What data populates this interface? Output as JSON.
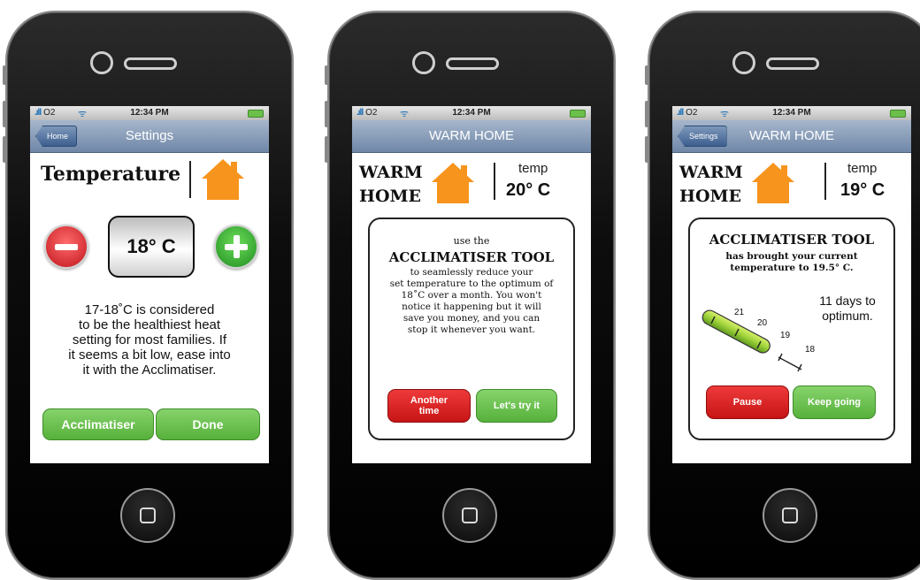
{
  "status": {
    "carrier": "O2",
    "time": "12:34 PM"
  },
  "screen1": {
    "nav": {
      "back": "Home",
      "title": "Settings"
    },
    "heading": "Temperature",
    "temperature": "18° C",
    "info": "17-18˚C is considered\nto be the healthiest heat\nsetting for most families. If\nit seems a bit low, ease into\nit with the Acclimatiser.",
    "buttons": {
      "acclimatiser": "Acclimatiser",
      "done": "Done"
    }
  },
  "screen2": {
    "nav": {
      "title": "WARM HOME"
    },
    "title_line1": "WARM",
    "title_line2": "HOME",
    "temp_label": "temp",
    "temp_value": "20° C",
    "panel": {
      "use_the": "use the",
      "tool": "ACCLIMATISER TOOL",
      "description": "to seamlessly reduce your\nset temperature to the optimum of\n18˚C over a month.  You won't\nnotice it happening but it will\nsave you money, and you can\nstop it whenever you want."
    },
    "buttons": {
      "another": "Another\ntime",
      "try": "Let's try it"
    }
  },
  "screen3": {
    "nav": {
      "back": "Settings",
      "title": "WARM HOME"
    },
    "title_line1": "WARM",
    "title_line2": "HOME",
    "temp_label": "temp",
    "temp_value": "19° C",
    "panel": {
      "tool": "ACCLIMATISER TOOL",
      "description": "has brought your current\ntemperature to 19.5° C.",
      "days": "11 days to\noptimum.",
      "scale": [
        "21",
        "20",
        "19",
        "18"
      ],
      "progress_fraction": 0.33
    },
    "buttons": {
      "pause": "Pause",
      "keep": "Keep going"
    }
  },
  "colors": {
    "accent_orange": "#f7941d",
    "green": "#6cc04a",
    "red": "#d91e1e",
    "nav_blue": "#6f87a8"
  },
  "icons": [
    "house-icon",
    "minus-icon",
    "plus-icon",
    "wifi-icon",
    "battery-icon",
    "home-button-icon"
  ]
}
